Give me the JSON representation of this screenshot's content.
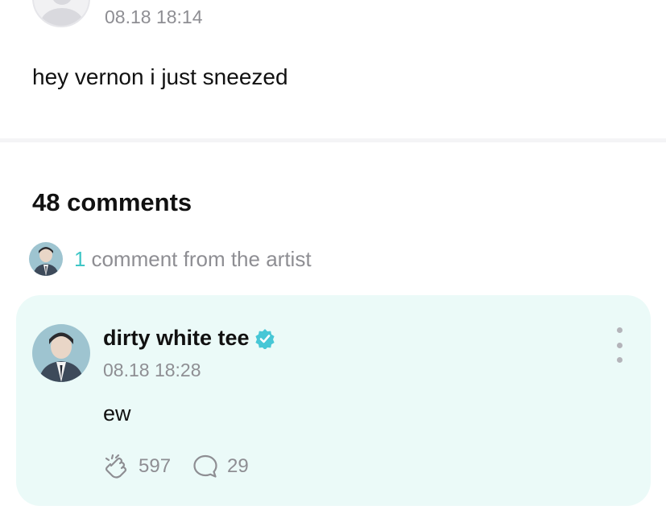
{
  "post": {
    "timestamp": "08.18 18:14",
    "text": "hey vernon i just sneezed"
  },
  "comments": {
    "count_label": "48 comments",
    "artist_summary": {
      "count": "1",
      "label": "comment from the artist"
    }
  },
  "artist_comment": {
    "author": "dirty white tee",
    "verified": true,
    "timestamp": "08.18 18:28",
    "text": "ew",
    "likes": "597",
    "replies": "29"
  },
  "colors": {
    "accent": "#3fc6c6",
    "card_background": "#ebfaf8",
    "muted_text": "#8e8e93",
    "verified_badge": "#47c7d6"
  },
  "icons": {
    "like": "hand-clap-icon",
    "reply": "speech-bubble-icon",
    "more": "vertical-ellipsis-icon",
    "verified": "verified-badge-icon"
  }
}
